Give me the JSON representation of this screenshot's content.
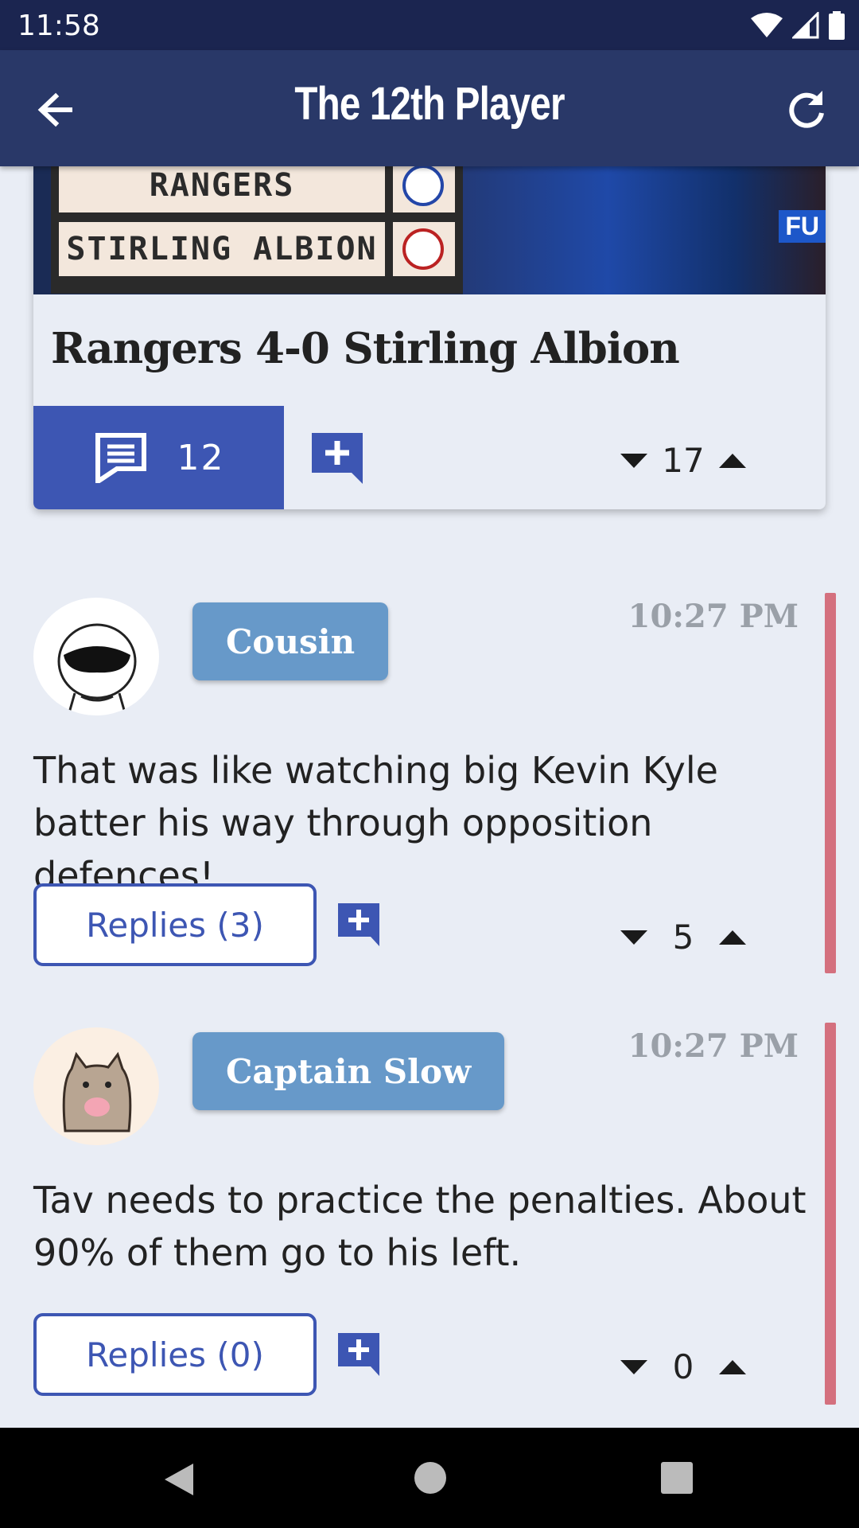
{
  "status_bar": {
    "time": "11:58"
  },
  "app_bar": {
    "title": "The 12th Player"
  },
  "article": {
    "image_text": {
      "row1": "RANGERS",
      "row2": "STIRLING ALBION",
      "sponsor": "FU"
    },
    "title": "Rangers 4-0 Stirling Albion",
    "comment_count": "12",
    "votes": "17"
  },
  "comments": [
    {
      "author": "Cousin",
      "time": "10:27 PM",
      "text": "That was like watching big Kevin Kyle batter his way through opposition defences!",
      "replies_label": "Replies (3)",
      "votes": "5",
      "avatar_icon": "helmet-avatar"
    },
    {
      "author": "Captain Slow",
      "time": "10:27 PM",
      "text": "Tav needs to practice the penalties. About 90% of them go to his left.",
      "replies_label": "Replies (0)",
      "votes": "0",
      "avatar_icon": "cat-avatar"
    }
  ],
  "colors": {
    "app_bar": "#293868",
    "status_bar": "#1b2550",
    "primary": "#3d56b3",
    "author_chip": "#6799c9",
    "thread_bar": "#d4707e",
    "background": "#e9edf5"
  }
}
